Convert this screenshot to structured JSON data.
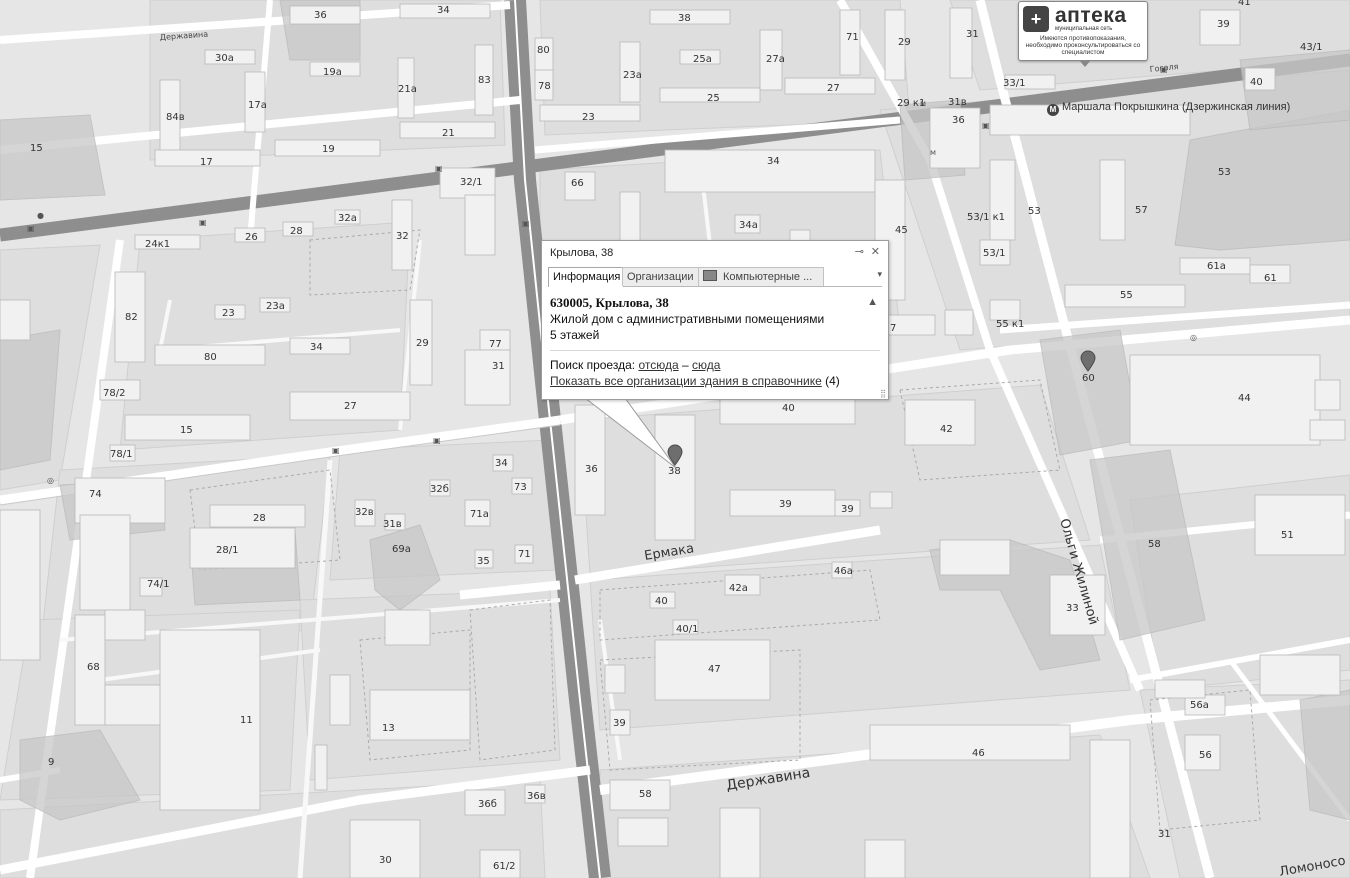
{
  "popup": {
    "header": "Крылова, 38",
    "pin_button": "⊸",
    "close_button": "✕",
    "tabs": [
      "Информация",
      "Организации",
      "Компьютерные ..."
    ],
    "active_tab": "Информация",
    "address": "630005, Крылова, 38",
    "description": "Жилой дом с административными помещениями",
    "floors": "5 этажей",
    "route_label": "Поиск проезда:",
    "route_from": "отсюда",
    "route_dash": "–",
    "route_to": "сюда",
    "show_all_link": "Показать все организации здания в справочнике",
    "org_count": "(4)",
    "warning_icon": "warning-icon"
  },
  "ad": {
    "brand": "аптека",
    "tagline": "муниципальная сеть",
    "disclaimer": "Имеются противопоказания, необходимо проконсультироваться со специалистом"
  },
  "metro": {
    "icon": "М",
    "station": "Маршала Покрышкина (Дзержинская линия)"
  },
  "streets": {
    "ermaka": "Ермака",
    "derzhavina": "Державина",
    "olgi_zhilinoi": "Ольги Жилиной",
    "lomonosova": "Ломоносо",
    "gogolya": "Гоголя",
    "derzhavina_top": "Державина"
  },
  "markers": {
    "selected": "38",
    "other": "60"
  },
  "houses": [
    "36",
    "34",
    "38",
    "39",
    "41",
    "43/1",
    "30а",
    "19а",
    "21а",
    "83",
    "80",
    "78",
    "23а",
    "25а",
    "27а",
    "71",
    "29",
    "31",
    "27",
    "25",
    "23",
    "17а",
    "84в",
    "17",
    "19",
    "21",
    "15",
    "33/1",
    "40",
    "29 к1",
    "31в",
    "32/1",
    "66",
    "34",
    "36",
    "53",
    "57",
    "45",
    "34а",
    "32а",
    "26",
    "28",
    "24к1",
    "32",
    "23а",
    "23",
    "82",
    "80",
    "34",
    "29",
    "77",
    "31",
    "78/2",
    "27",
    "15",
    "78/1",
    "74",
    "28",
    "32в",
    "31в",
    "32б",
    "34",
    "73",
    "71а",
    "69а",
    "35",
    "71",
    "28/1",
    "74/1",
    "36",
    "38",
    "39",
    "39",
    "40",
    "42",
    "44",
    "61а",
    "61",
    "53/1 к1",
    "53/1",
    "55",
    "55 к1",
    "58",
    "51",
    "46а",
    "42а",
    "40",
    "40/1",
    "47",
    "33",
    "68",
    "11",
    "13",
    "9",
    "39",
    "58",
    "36б",
    "36в",
    "30",
    "61/2",
    "56а",
    "56",
    "46",
    "31",
    "60",
    "7"
  ]
}
